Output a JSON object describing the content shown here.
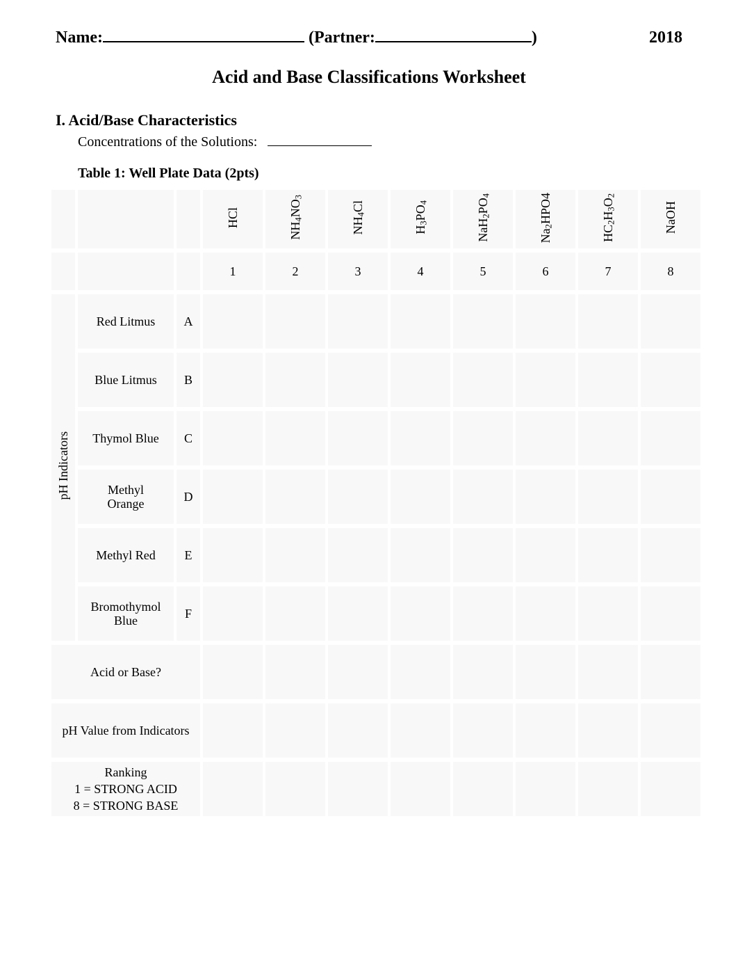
{
  "header": {
    "name_label": "Name:",
    "partner_label": "(Partner:",
    "partner_close": ")",
    "year": "2018"
  },
  "title": "Acid and Base Classifications Worksheet",
  "section1": {
    "heading": "I. Acid/Base Characteristics",
    "sub_label": "Concentrations of the Solutions:"
  },
  "table_caption": "Table 1: Well Plate Data (2pts)",
  "columns": {
    "c1_html": "HCl",
    "c2_html": "NH<sub>4</sub>NO<sub>3</sub>",
    "c3_html": "NH<sub>4</sub>Cl",
    "c4_html": "H<sub>3</sub>PO<sub>4</sub>",
    "c5_html": "NaH<sub>2</sub>PO<sub>4</sub>",
    "c6_html": "Na<sub>2</sub>HPO4",
    "c7_html": "HC<sub>2</sub>H<sub>3</sub>O<sub>2</sub>",
    "c8_html": "NaOH"
  },
  "col_nums": {
    "n1": "1",
    "n2": "2",
    "n3": "3",
    "n4": "4",
    "n5": "5",
    "n6": "6",
    "n7": "7",
    "n8": "8"
  },
  "vert_group": "pH Indicators",
  "indicator_rows": [
    {
      "label": "Red Litmus",
      "letter": "A"
    },
    {
      "label": "Blue Litmus",
      "letter": "B"
    },
    {
      "label": "Thymol Blue",
      "letter": "C"
    },
    {
      "label_l1": "Methyl",
      "label_l2": "Orange",
      "letter": "D"
    },
    {
      "label": "Methyl Red",
      "letter": "E"
    },
    {
      "label_l1": "Bromothymol",
      "label_l2": "Blue",
      "letter": "F"
    }
  ],
  "footer_rows": {
    "acid_or_base": "Acid or Base?",
    "ph_from_indicators": "pH Value from Indicators",
    "ranking_l1": "Ranking",
    "ranking_l2": "1 = STRONG ACID",
    "ranking_l3": "8 = STRONG BASE"
  }
}
